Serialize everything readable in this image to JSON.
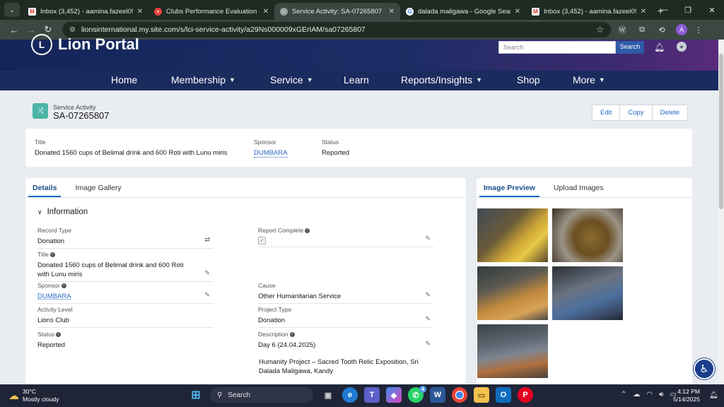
{
  "browser": {
    "tabs": [
      {
        "icon": "gmail-icon",
        "title": "Inbox (3,452) - aamina.fazeel09",
        "active": false
      },
      {
        "icon": "chrome-icon",
        "title": "Clubs Performance Evaluation S",
        "active": false
      },
      {
        "icon": "globe-icon",
        "title": "Service Activity: SA-07265807",
        "active": true
      },
      {
        "icon": "google-icon",
        "title": "dalada maligawa - Google Sear",
        "active": false
      },
      {
        "icon": "gmail-icon",
        "title": "Inbox (3,452) - aamina.fazeel09",
        "active": false
      }
    ],
    "url": "lionsinternational.my.site.com/s/lci-service-activity/a29Ns000009xGErIAM/sa07265807",
    "profile_initial": "A"
  },
  "site": {
    "brand": "Lion Portal",
    "logo_text": "L",
    "search_placeholder": "Search",
    "search_button": "Search",
    "nav": [
      {
        "label": "Home",
        "has_menu": false
      },
      {
        "label": "Membership",
        "has_menu": true
      },
      {
        "label": "Service",
        "has_menu": true
      },
      {
        "label": "Learn",
        "has_menu": false
      },
      {
        "label": "Reports/Insights",
        "has_menu": true
      },
      {
        "label": "Shop",
        "has_menu": false
      },
      {
        "label": "More",
        "has_menu": true
      }
    ]
  },
  "record": {
    "type_label": "Service Activity",
    "name": "SA-07265807",
    "buttons": {
      "edit": "Edit",
      "copy": "Copy",
      "delete": "Delete"
    }
  },
  "highlights": {
    "title_label": "Title",
    "title_value": "Donated 1560 cups of Belimal drink and 600 Roti with Lunu miris",
    "sponsor_label": "Sponsor",
    "sponsor_value": "DUMBARA",
    "status_label": "Status",
    "status_value": "Reported"
  },
  "details": {
    "tabs": [
      "Details",
      "Image Gallery"
    ],
    "section": "Information",
    "fields": {
      "record_type": {
        "label": "Record Type",
        "value": "Donation"
      },
      "report_complete": {
        "label": "Report Complete",
        "checked": true
      },
      "title": {
        "label": "Title",
        "value": "Donated 1560 cups of Belimal drink and 600 Roti with Lunu miris"
      },
      "sponsor": {
        "label": "Sponsor",
        "value": "DUMBARA"
      },
      "cause": {
        "label": "Cause",
        "value": "Other Humanitarian Service"
      },
      "activity_level": {
        "label": "Activity Level",
        "value": "Lions Club"
      },
      "project_type": {
        "label": "Project Type",
        "value": "Donation"
      },
      "status": {
        "label": "Status",
        "value": "Reported"
      },
      "description": {
        "label": "Description",
        "value": "Day 6 (24.04.2025)",
        "value2": "Humanity Project – Sacred Tooth Relic Exposition, Sri Dalada Maligawa, Kandy"
      }
    }
  },
  "images_panel": {
    "tabs": [
      "Image Preview",
      "Upload Images"
    ]
  },
  "taskbar": {
    "temp": "30°C",
    "weather": "Mostly cloudy",
    "search_label": "Search",
    "whatsapp_badge": "4",
    "time": "4:12 PM",
    "date": "5/14/2025"
  }
}
